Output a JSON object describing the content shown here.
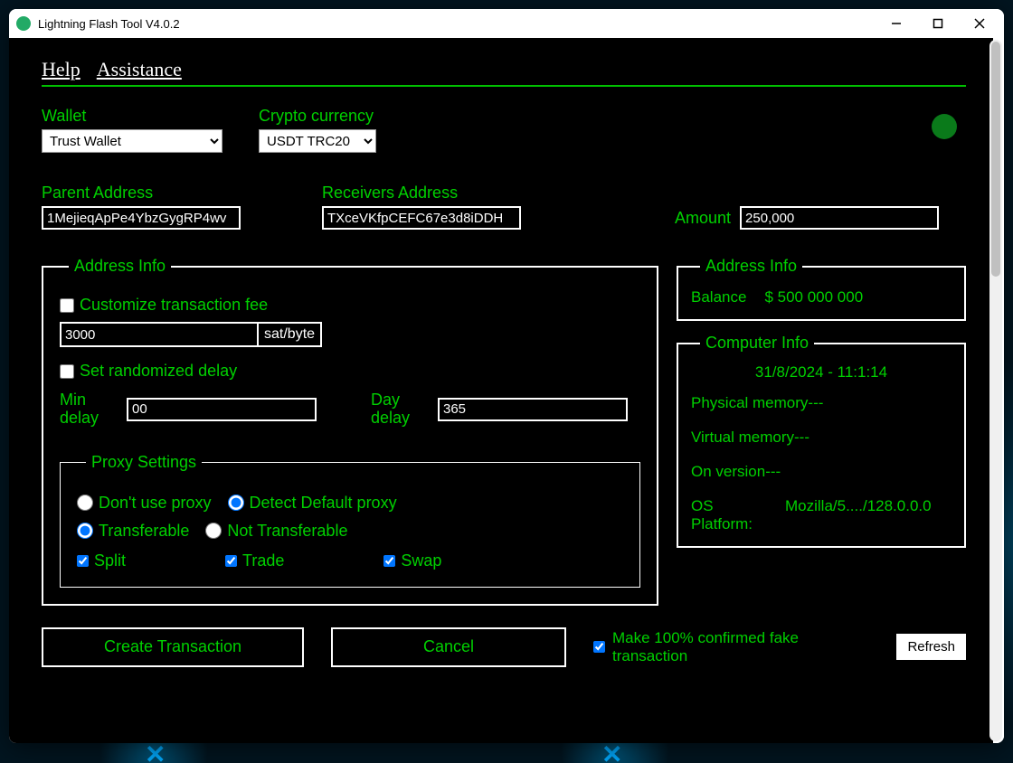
{
  "window": {
    "title": "Lightning Flash Tool V4.0.2"
  },
  "menu": {
    "help": "Help",
    "assistance": "Assistance"
  },
  "wallet": {
    "label": "Wallet",
    "value": "Trust Wallet",
    "crypto_label": "Crypto currency",
    "crypto_value": "USDT TRC20"
  },
  "addresses": {
    "parent_label": "Parent Address",
    "parent_value": "1MejieqApPe4YbzGygRP4wv",
    "receiver_label": "Receivers Address",
    "receiver_value": "TXceVKfpCEFC67e3d8iDDH",
    "amount_label": "Amount",
    "amount_value": "250,000"
  },
  "addressInfo": {
    "legend": "Address Info",
    "customize_fee": "Customize transaction fee",
    "fee_value": "3000",
    "fee_unit": "sat/byte",
    "randomized": "Set randomized delay",
    "min_delay_label": "Min delay",
    "min_delay_value": "00",
    "day_delay_label": "Day delay",
    "day_delay_value": "365"
  },
  "proxy": {
    "legend": "Proxy Settings",
    "no_proxy": "Don't use proxy",
    "detect": "Detect Default proxy",
    "transferable": "Transferable",
    "not_transferable": "Not Transferable",
    "split": "Split",
    "trade": "Trade",
    "swap": "Swap"
  },
  "balance": {
    "legend": "Address Info",
    "label": "Balance",
    "value": "$ 500 000 000"
  },
  "computer": {
    "legend": "Computer Info",
    "datetime": "31/8/2024 - 11:1:14",
    "phys": "Physical memory---",
    "virt": "Virtual memory---",
    "onver": "On version---",
    "os_label": "OS Platform:",
    "os_value": "Mozilla/5..../128.0.0.0"
  },
  "actions": {
    "create": "Create Transaction",
    "cancel": "Cancel",
    "confirm": "Make 100% confirmed fake transaction",
    "refresh": "Refresh"
  }
}
